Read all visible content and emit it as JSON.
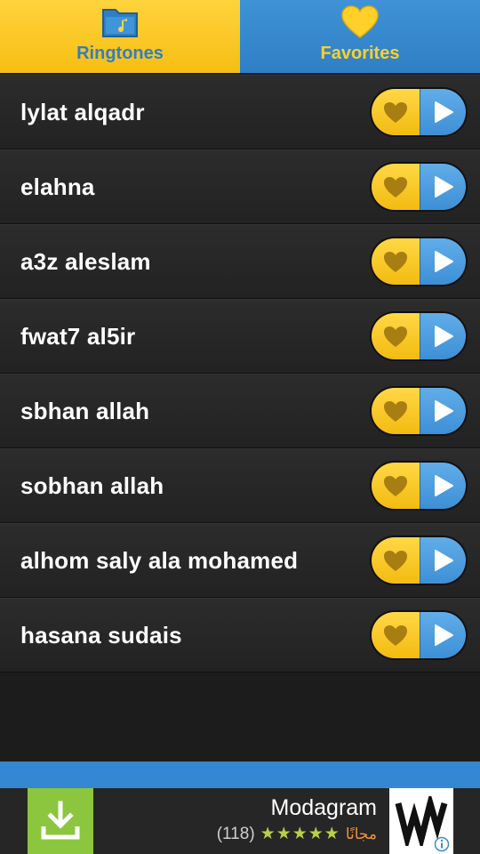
{
  "tabs": [
    {
      "label": "Ringtones",
      "icon": "folder-music-icon",
      "active": true
    },
    {
      "label": "Favorites",
      "icon": "heart-icon",
      "active": false
    }
  ],
  "ringtones": [
    {
      "title": "lylat alqadr"
    },
    {
      "title": "elahna"
    },
    {
      "title": "a3z aleslam"
    },
    {
      "title": "fwat7 al5ir"
    },
    {
      "title": "sbhan allah"
    },
    {
      "title": "sobhan allah"
    },
    {
      "title": "alhom saly ala mohamed"
    },
    {
      "title": "hasana sudais"
    }
  ],
  "ad": {
    "app_name": "Modagram",
    "rating_count": "(118)",
    "stars": "★★★★★",
    "price_label": "مجانًا",
    "download_icon": "download-icon",
    "logo_icon": "modagram-logo-icon",
    "info_icon": "info-icon"
  },
  "colors": {
    "tab_active": "#f6be12",
    "tab_inactive": "#2f7fc4",
    "fav_button": "#f2bb10",
    "play_button": "#3d8fd6",
    "ad_download": "#8cc63f"
  }
}
